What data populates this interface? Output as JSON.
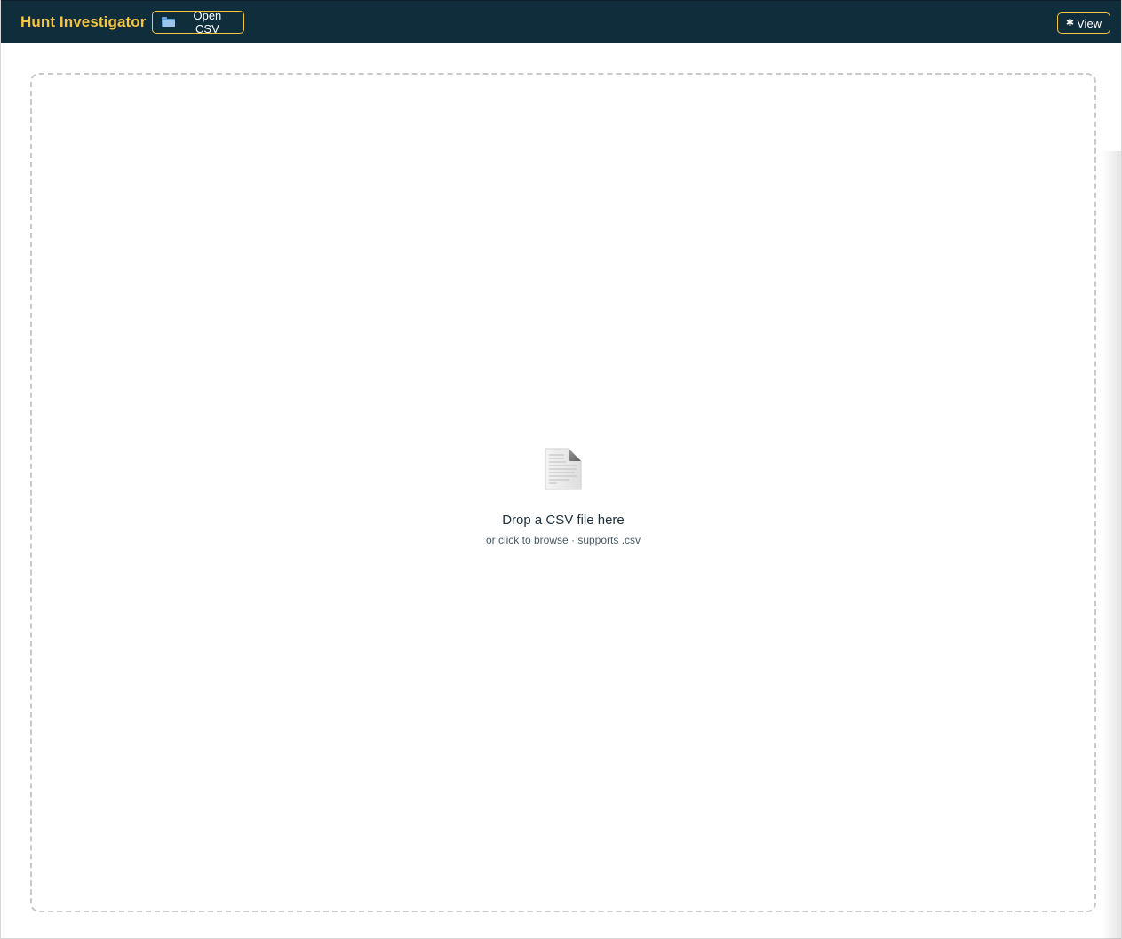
{
  "header": {
    "title": "Hunt Investigator",
    "open_csv_label": "Open CSV",
    "view_label": "View",
    "brand_color": "#f5c542",
    "bar_color": "#102d3c"
  },
  "icons": {
    "open_csv": "folder-icon",
    "view": "gear-icon",
    "dropzone": "document-icon"
  },
  "dropzone": {
    "title": "Drop a CSV file here",
    "subtitle": "or click to browse · supports .csv"
  }
}
